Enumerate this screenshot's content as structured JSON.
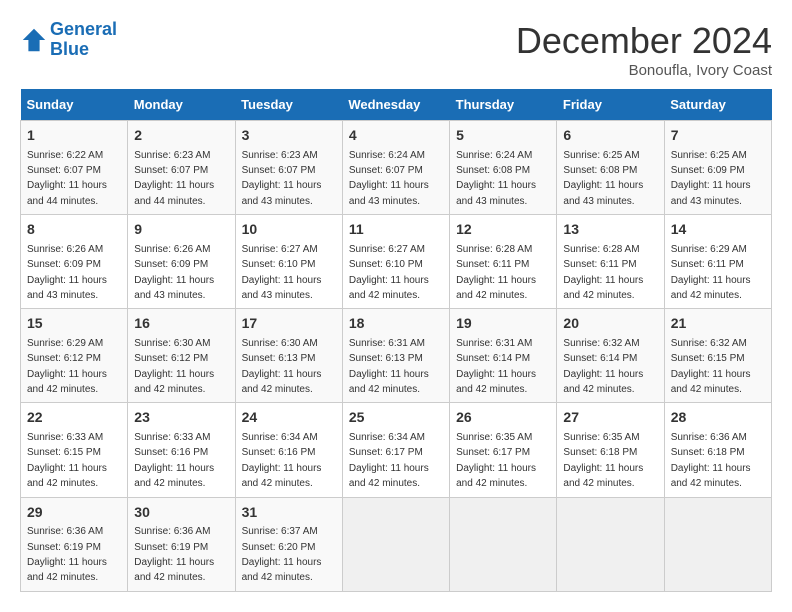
{
  "header": {
    "logo_line1": "General",
    "logo_line2": "Blue",
    "month_title": "December 2024",
    "location": "Bonoufla, Ivory Coast"
  },
  "days_of_week": [
    "Sunday",
    "Monday",
    "Tuesday",
    "Wednesday",
    "Thursday",
    "Friday",
    "Saturday"
  ],
  "weeks": [
    [
      {
        "day": "1",
        "sunrise": "6:22 AM",
        "sunset": "6:07 PM",
        "daylight": "11 hours and 44 minutes."
      },
      {
        "day": "2",
        "sunrise": "6:23 AM",
        "sunset": "6:07 PM",
        "daylight": "11 hours and 44 minutes."
      },
      {
        "day": "3",
        "sunrise": "6:23 AM",
        "sunset": "6:07 PM",
        "daylight": "11 hours and 43 minutes."
      },
      {
        "day": "4",
        "sunrise": "6:24 AM",
        "sunset": "6:07 PM",
        "daylight": "11 hours and 43 minutes."
      },
      {
        "day": "5",
        "sunrise": "6:24 AM",
        "sunset": "6:08 PM",
        "daylight": "11 hours and 43 minutes."
      },
      {
        "day": "6",
        "sunrise": "6:25 AM",
        "sunset": "6:08 PM",
        "daylight": "11 hours and 43 minutes."
      },
      {
        "day": "7",
        "sunrise": "6:25 AM",
        "sunset": "6:09 PM",
        "daylight": "11 hours and 43 minutes."
      }
    ],
    [
      {
        "day": "8",
        "sunrise": "6:26 AM",
        "sunset": "6:09 PM",
        "daylight": "11 hours and 43 minutes."
      },
      {
        "day": "9",
        "sunrise": "6:26 AM",
        "sunset": "6:09 PM",
        "daylight": "11 hours and 43 minutes."
      },
      {
        "day": "10",
        "sunrise": "6:27 AM",
        "sunset": "6:10 PM",
        "daylight": "11 hours and 43 minutes."
      },
      {
        "day": "11",
        "sunrise": "6:27 AM",
        "sunset": "6:10 PM",
        "daylight": "11 hours and 42 minutes."
      },
      {
        "day": "12",
        "sunrise": "6:28 AM",
        "sunset": "6:11 PM",
        "daylight": "11 hours and 42 minutes."
      },
      {
        "day": "13",
        "sunrise": "6:28 AM",
        "sunset": "6:11 PM",
        "daylight": "11 hours and 42 minutes."
      },
      {
        "day": "14",
        "sunrise": "6:29 AM",
        "sunset": "6:11 PM",
        "daylight": "11 hours and 42 minutes."
      }
    ],
    [
      {
        "day": "15",
        "sunrise": "6:29 AM",
        "sunset": "6:12 PM",
        "daylight": "11 hours and 42 minutes."
      },
      {
        "day": "16",
        "sunrise": "6:30 AM",
        "sunset": "6:12 PM",
        "daylight": "11 hours and 42 minutes."
      },
      {
        "day": "17",
        "sunrise": "6:30 AM",
        "sunset": "6:13 PM",
        "daylight": "11 hours and 42 minutes."
      },
      {
        "day": "18",
        "sunrise": "6:31 AM",
        "sunset": "6:13 PM",
        "daylight": "11 hours and 42 minutes."
      },
      {
        "day": "19",
        "sunrise": "6:31 AM",
        "sunset": "6:14 PM",
        "daylight": "11 hours and 42 minutes."
      },
      {
        "day": "20",
        "sunrise": "6:32 AM",
        "sunset": "6:14 PM",
        "daylight": "11 hours and 42 minutes."
      },
      {
        "day": "21",
        "sunrise": "6:32 AM",
        "sunset": "6:15 PM",
        "daylight": "11 hours and 42 minutes."
      }
    ],
    [
      {
        "day": "22",
        "sunrise": "6:33 AM",
        "sunset": "6:15 PM",
        "daylight": "11 hours and 42 minutes."
      },
      {
        "day": "23",
        "sunrise": "6:33 AM",
        "sunset": "6:16 PM",
        "daylight": "11 hours and 42 minutes."
      },
      {
        "day": "24",
        "sunrise": "6:34 AM",
        "sunset": "6:16 PM",
        "daylight": "11 hours and 42 minutes."
      },
      {
        "day": "25",
        "sunrise": "6:34 AM",
        "sunset": "6:17 PM",
        "daylight": "11 hours and 42 minutes."
      },
      {
        "day": "26",
        "sunrise": "6:35 AM",
        "sunset": "6:17 PM",
        "daylight": "11 hours and 42 minutes."
      },
      {
        "day": "27",
        "sunrise": "6:35 AM",
        "sunset": "6:18 PM",
        "daylight": "11 hours and 42 minutes."
      },
      {
        "day": "28",
        "sunrise": "6:36 AM",
        "sunset": "6:18 PM",
        "daylight": "11 hours and 42 minutes."
      }
    ],
    [
      {
        "day": "29",
        "sunrise": "6:36 AM",
        "sunset": "6:19 PM",
        "daylight": "11 hours and 42 minutes."
      },
      {
        "day": "30",
        "sunrise": "6:36 AM",
        "sunset": "6:19 PM",
        "daylight": "11 hours and 42 minutes."
      },
      {
        "day": "31",
        "sunrise": "6:37 AM",
        "sunset": "6:20 PM",
        "daylight": "11 hours and 42 minutes."
      },
      null,
      null,
      null,
      null
    ]
  ]
}
